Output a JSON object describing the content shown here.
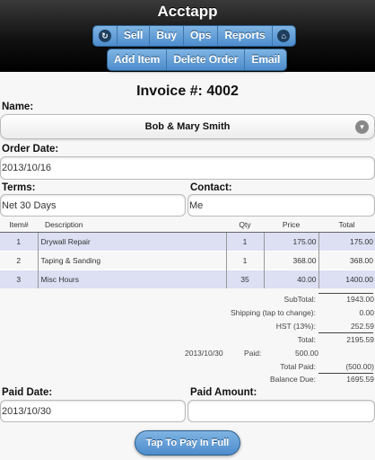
{
  "app": {
    "title": "Acctapp"
  },
  "nav": {
    "back_icon": "refresh-icon",
    "items": [
      {
        "label": "Sell"
      },
      {
        "label": "Buy"
      },
      {
        "label": "Ops"
      },
      {
        "label": "Reports"
      }
    ],
    "home_icon": "home-icon",
    "actions": [
      {
        "label": "Add Item"
      },
      {
        "label": "Delete Order"
      },
      {
        "label": "Email"
      }
    ]
  },
  "invoice": {
    "title": "Invoice #: 4002",
    "name_label": "Name:",
    "name_value": "Bob & Mary Smith",
    "order_date_label": "Order Date:",
    "order_date_value": "2013/10/16",
    "terms_label": "Terms:",
    "terms_value": "Net 30 Days",
    "contact_label": "Contact:",
    "contact_value": "Me"
  },
  "table": {
    "headers": [
      "Item#",
      "Description",
      "Qty",
      "Price",
      "Total"
    ],
    "rows": [
      {
        "item": "1",
        "description": "Drywall Repair",
        "qty": "1",
        "price": "175.00",
        "total": "175.00"
      },
      {
        "item": "2",
        "description": "Taping & Sanding",
        "qty": "1",
        "price": "368.00",
        "total": "368.00"
      },
      {
        "item": "3",
        "description": "Misc Hours",
        "qty": "35",
        "price": "40.00",
        "total": "1400.00"
      }
    ]
  },
  "totals": {
    "subtotal_label": "SubTotal:",
    "subtotal_value": "1943.00",
    "shipping_label": "Shipping (tap to change):",
    "shipping_value": "0.00",
    "hst_label": "HST (13%):",
    "hst_value": "252.59",
    "total_label": "Total:",
    "total_value": "2195.59",
    "paid_date": "2013/10/30",
    "paid_label": "Paid:",
    "paid_value": "500.00",
    "total_paid_label": "Total Paid:",
    "total_paid_value": "(500.00)",
    "balance_label": "Balance Due:",
    "balance_value": "1695.59"
  },
  "payment": {
    "paid_date_label": "Paid Date:",
    "paid_date_value": "2013/10/30",
    "paid_amount_label": "Paid Amount:",
    "paid_amount_value": "",
    "pay_button": "Tap To Pay In Full"
  },
  "colors": {
    "accent": "#5b97d3",
    "row_highlight": "#dde0f3",
    "header_bg": "#111111"
  }
}
